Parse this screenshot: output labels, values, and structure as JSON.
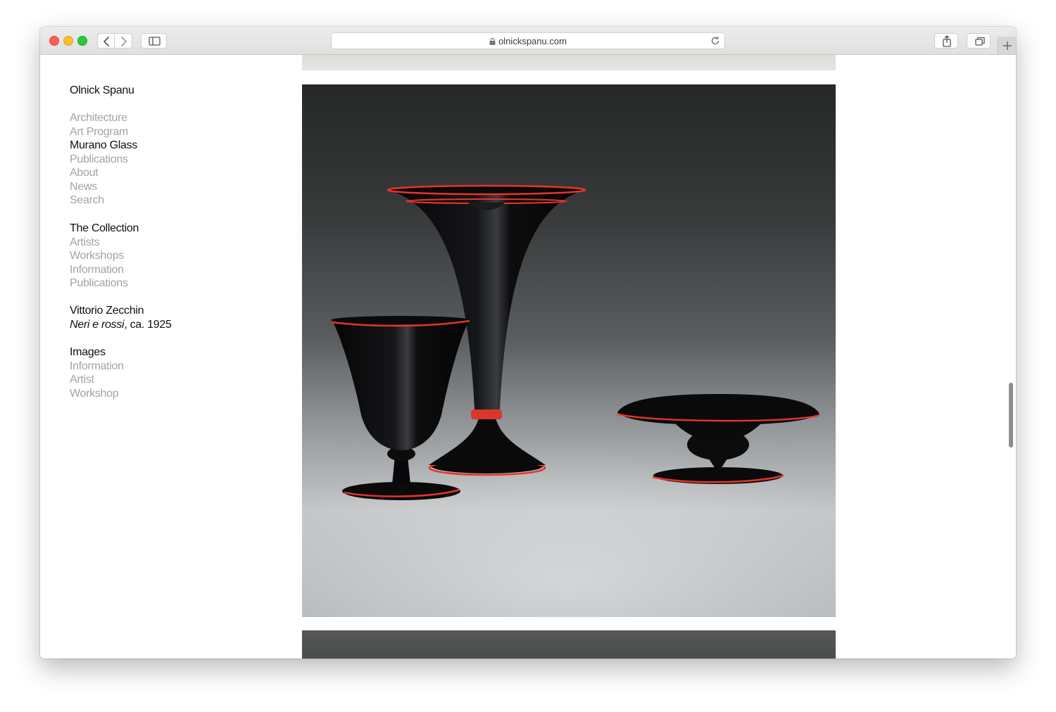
{
  "browser": {
    "url": "olnickspanu.com",
    "icons": {
      "back": "chevron-left-icon",
      "forward": "chevron-right-icon",
      "sidebar": "sidebar-icon",
      "lock": "lock-icon",
      "reload": "reload-icon",
      "share": "share-icon",
      "tabs": "tabs-overview-icon",
      "new_tab": "plus-icon"
    }
  },
  "site": {
    "title": "Olnick Spanu"
  },
  "nav_main": [
    {
      "label": "Architecture",
      "active": false
    },
    {
      "label": "Art Program",
      "active": false
    },
    {
      "label": "Murano Glass",
      "active": true
    },
    {
      "label": "Publications",
      "active": false
    },
    {
      "label": "About",
      "active": false
    },
    {
      "label": "News",
      "active": false
    },
    {
      "label": "Search",
      "active": false
    }
  ],
  "collection": {
    "heading": "The Collection",
    "items": [
      "Artists",
      "Workshops",
      "Information",
      "Publications"
    ]
  },
  "work": {
    "artist": "Vittorio Zecchin",
    "title": "Neri e rossi",
    "date": ", ca. 1925"
  },
  "images_section": {
    "heading": "Images",
    "items": [
      "Information",
      "Artist",
      "Workshop"
    ]
  },
  "colors": {
    "accent_red": "#e8332a",
    "glass_black": "#0b0b0c",
    "muted_text": "#a3a3a3"
  }
}
